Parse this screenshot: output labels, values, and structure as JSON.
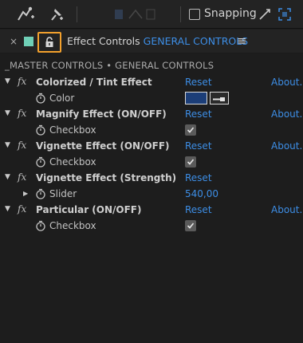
{
  "toolbar": {
    "snapping_label": "Snapping",
    "snapping_checked": false,
    "icons": [
      "puppet-pin-icon",
      "pin-icon",
      "align-icon",
      "snap-options-icon",
      "expand-icon"
    ]
  },
  "panel": {
    "close_label": "×",
    "title_prefix": "Effect Controls",
    "title_layer": "GENERAL CONTROLS",
    "menu_label": "≡",
    "accent_color": "#3d8ee6",
    "lock_highlight_color": "#f3a12d",
    "label_color": "#6fcfb6"
  },
  "section_title": "_MASTER CONTROLS • GENERAL CONTROLS",
  "effects": [
    {
      "name": "Colorized / Tint Effect",
      "reset": "Reset",
      "about": "About...",
      "param": {
        "name": "Color",
        "type": "color",
        "value": "#1c3e78"
      }
    },
    {
      "name": "Magnify Effect (ON/OFF)",
      "reset": "Reset",
      "about": "About...",
      "param": {
        "name": "Checkbox",
        "type": "checkbox",
        "checked": true
      }
    },
    {
      "name": "Vignette Effect (ON/OFF)",
      "reset": "Reset",
      "about": "About...",
      "param": {
        "name": "Checkbox",
        "type": "checkbox",
        "checked": true
      }
    },
    {
      "name": "Vignette Effect (Strength)",
      "reset": "Reset",
      "about": "",
      "param": {
        "name": "Slider",
        "type": "slider",
        "value": "540,00"
      }
    },
    {
      "name": "Particular (ON/OFF)",
      "reset": "Reset",
      "about": "About...",
      "param": {
        "name": "Checkbox",
        "type": "checkbox",
        "checked": true
      }
    }
  ]
}
